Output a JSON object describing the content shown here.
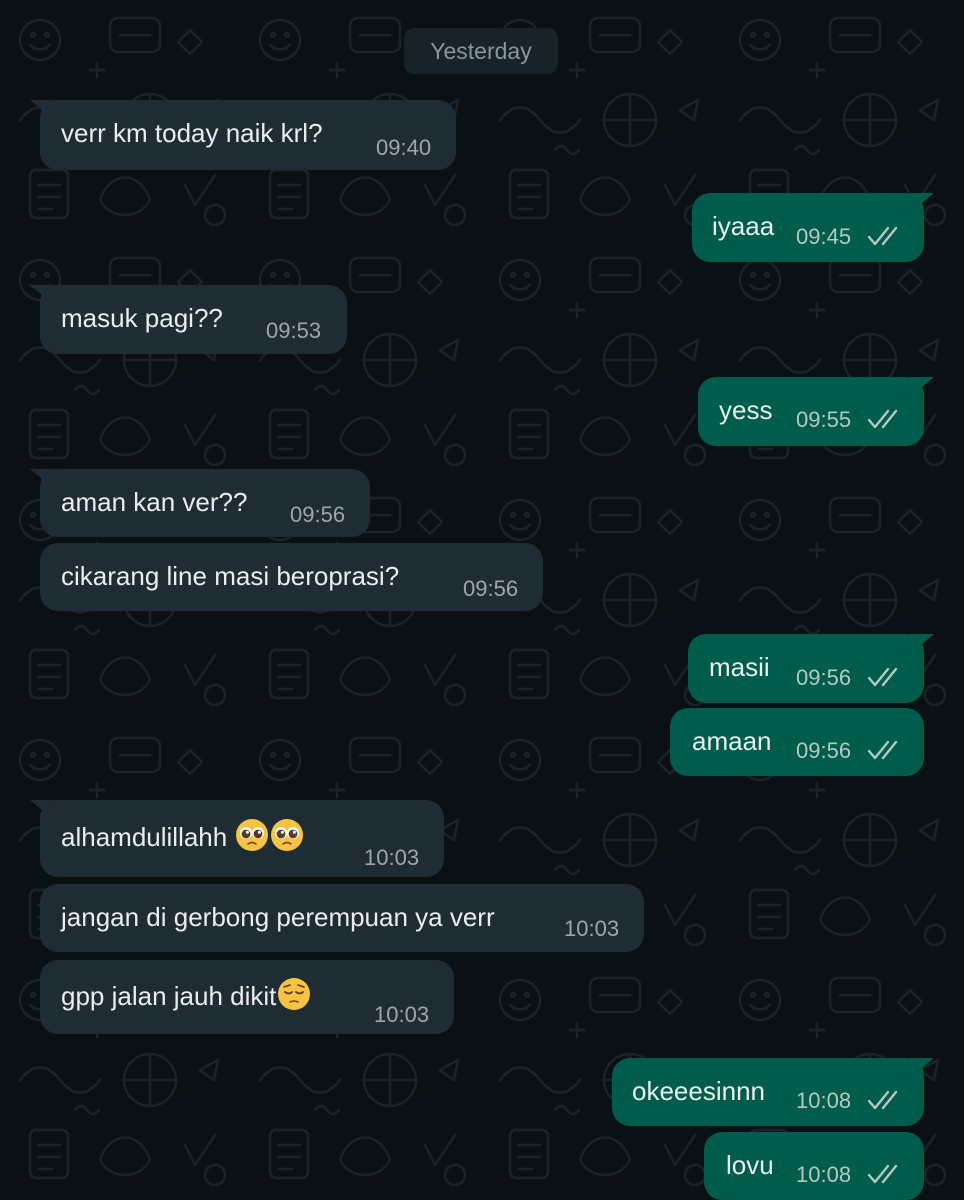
{
  "date_separator": "Yesterday",
  "colors": {
    "background": "#0b1014",
    "incoming_bubble": "#202c33",
    "outgoing_bubble": "#005c4b",
    "text": "#e9edef",
    "timestamp": "#8696a0",
    "read_ticks": "#b6c8c2"
  },
  "messages": [
    {
      "direction": "in",
      "text": "verr km today naik krl?",
      "time": "09:40"
    },
    {
      "direction": "out",
      "text": "iyaaa",
      "time": "09:45",
      "status": "read"
    },
    {
      "direction": "in",
      "text": "masuk pagi??",
      "time": "09:53"
    },
    {
      "direction": "out",
      "text": "yess",
      "time": "09:55",
      "status": "read"
    },
    {
      "direction": "in",
      "text": "aman kan ver??",
      "time": "09:56"
    },
    {
      "direction": "in",
      "text": "cikarang line masi beroprasi?",
      "time": "09:56"
    },
    {
      "direction": "out",
      "text": "masii",
      "time": "09:56",
      "status": "read"
    },
    {
      "direction": "out",
      "text": "amaan",
      "time": "09:56",
      "status": "read"
    },
    {
      "direction": "in",
      "text": "alhamdulillahh",
      "emoji": [
        "pleading-face-emoji",
        "pleading-face-emoji"
      ],
      "time": "10:03"
    },
    {
      "direction": "in",
      "text": "jangan di gerbong perempuan ya verr",
      "time": "10:03"
    },
    {
      "direction": "in",
      "text": "gpp jalan jauh dikit",
      "emoji": [
        "pensive-face-emoji"
      ],
      "time": "10:03"
    },
    {
      "direction": "out",
      "text": "okeeesinnn",
      "time": "10:08",
      "status": "read"
    },
    {
      "direction": "out",
      "text": "lovu",
      "time": "10:08",
      "status": "read"
    }
  ]
}
